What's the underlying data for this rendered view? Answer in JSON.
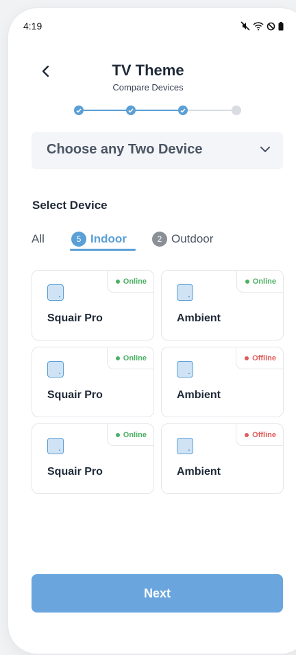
{
  "status_bar": {
    "time": "4:19",
    "icons": [
      "mute-icon",
      "wifi-icon",
      "dnd-icon",
      "battery-icon"
    ]
  },
  "header": {
    "title": "TV Theme",
    "subtitle": "Compare Devices",
    "back_icon": "chevron-left-icon"
  },
  "stepper": {
    "total_steps": 4,
    "completed_steps": 3,
    "accent": "#5a9fd6"
  },
  "selector": {
    "label": "Choose any Two Device",
    "icon": "chevron-down-icon"
  },
  "section_title": "Select Device",
  "tabs": [
    {
      "label": "All"
    },
    {
      "label": "Indoor",
      "count": "5",
      "active": true
    },
    {
      "label": "Outdoor",
      "count": "2"
    }
  ],
  "devices": [
    {
      "name": "Squair Pro",
      "status": "Online"
    },
    {
      "name": "Ambient",
      "status": "Online"
    },
    {
      "name": "Squair Pro",
      "status": "Online"
    },
    {
      "name": "Ambient",
      "status": "Offline"
    },
    {
      "name": "Squair Pro",
      "status": "Online"
    },
    {
      "name": "Ambient",
      "status": "Offline"
    }
  ],
  "colors": {
    "online": "#4caf63",
    "offline": "#e05a5a",
    "primary": "#6aa6dd"
  },
  "next_button": {
    "label": "Next"
  }
}
